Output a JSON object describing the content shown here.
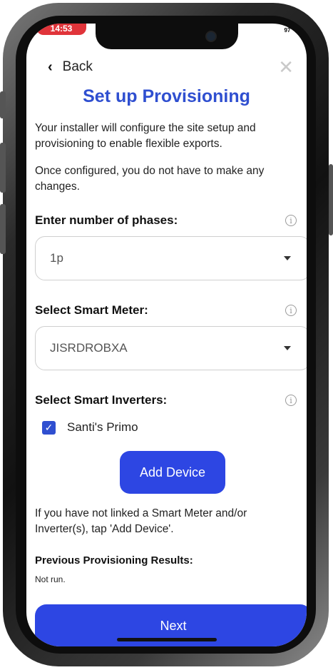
{
  "status_bar": {
    "time": "14:53",
    "battery": "97"
  },
  "header": {
    "back_label": "Back",
    "close_symbol": "✕"
  },
  "page": {
    "title": "Set up Provisioning",
    "intro": "Your installer will configure the site setup and provisioning to enable flexible exports.",
    "note": "Once configured, you do not have to make any changes."
  },
  "phases": {
    "label": "Enter number of phases:",
    "value": "1p"
  },
  "smart_meter": {
    "label": "Select Smart Meter:",
    "value": "JISRDROBXA"
  },
  "smart_inverters": {
    "label": "Select Smart Inverters:",
    "items": [
      {
        "label": "Santi's Primo",
        "checked": true
      }
    ]
  },
  "add_device_label": "Add Device",
  "help_text": "If you have not linked a Smart Meter and/or Inverter(s), tap 'Add Device'.",
  "previous_results": {
    "label": "Previous Provisioning Results:",
    "value": "Not run."
  },
  "next_label": "Next",
  "colors": {
    "accent": "#2d46e3",
    "title": "#2f4fd0"
  },
  "icons": {
    "info": "info-icon",
    "back": "chevron-left-icon",
    "close": "close-icon",
    "dropdown": "caret-down-icon",
    "check": "checkmark-icon"
  }
}
